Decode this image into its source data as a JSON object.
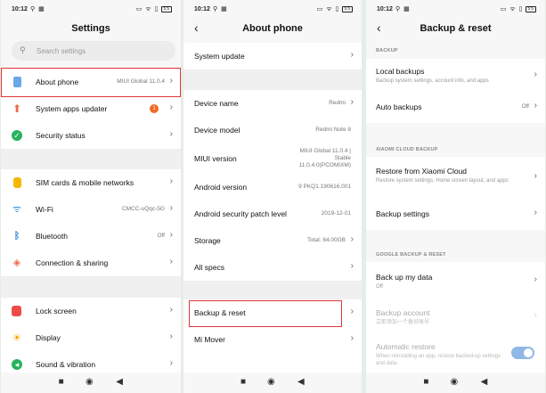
{
  "statusbar": {
    "time": "10:12",
    "left_icons": "⚲ ▦",
    "right_icons": "▭ ᯤ ▯",
    "battery": "55"
  },
  "panel1": {
    "title": "Settings",
    "search_placeholder": "Search settings",
    "items": [
      {
        "label": "About phone",
        "value": "MIUI Global 11.0.4",
        "icon_color": "#6aa8e8"
      },
      {
        "label": "System apps updater",
        "badge": "1",
        "icon_color": "#ef6b4c"
      },
      {
        "label": "Security status",
        "icon_color": "#27b35c"
      },
      {
        "label": "SIM cards & mobile networks",
        "icon_color": "#f5b800"
      },
      {
        "label": "Wi-Fi",
        "value": "CMCC-uQqc-5G",
        "icon_color": "#2b8ce0"
      },
      {
        "label": "Bluetooth",
        "value": "Off",
        "icon_color": "#2b8ce0"
      },
      {
        "label": "Connection & sharing",
        "icon_color": "#ef6b4c"
      },
      {
        "label": "Lock screen",
        "icon_color": "#ef4b4b"
      },
      {
        "label": "Display",
        "icon_color": "#f5a800"
      },
      {
        "label": "Sound & vibration",
        "icon_color": "#27b35c"
      }
    ]
  },
  "panel2": {
    "title": "About phone",
    "items": [
      {
        "label": "System update",
        "value": ""
      },
      {
        "label": "Device name",
        "value": "Redmi"
      },
      {
        "label": "Device model",
        "value": "Redmi Note 8"
      },
      {
        "label": "MIUI version",
        "value_lines": [
          "MIUI Global 11.0.4 |",
          "Stable",
          "11.0.4.0(PCOMIXM)"
        ]
      },
      {
        "label": "Android version",
        "value": "9 PKQ1.190616.001"
      },
      {
        "label": "Android security patch level",
        "value": "2019-12-01"
      },
      {
        "label": "Storage",
        "value": "Total: 64.00GB"
      },
      {
        "label": "All specs",
        "value": ""
      },
      {
        "label": "Backup & reset",
        "value": ""
      },
      {
        "label": "Mi Mover",
        "value": ""
      }
    ]
  },
  "panel3": {
    "title": "Backup & reset",
    "section_backup": "BACKUP",
    "local_backups": {
      "label": "Local backups",
      "sub": "Backup system settings, account info, and apps"
    },
    "auto_backups": {
      "label": "Auto backups",
      "value": "Off"
    },
    "section_cloud": "XIAOMI CLOUD BACKUP",
    "restore_cloud": {
      "label": "Restore from Xiaomi Cloud",
      "sub": "Restore system settings, Home screen layout, and apps"
    },
    "backup_settings": {
      "label": "Backup settings"
    },
    "section_google": "GOOGLE BACKUP & RESET",
    "back_up_data": {
      "label": "Back up my data",
      "sub": "Off"
    },
    "backup_account": {
      "label": "Backup account",
      "sub": "立即添加一个备份账号"
    },
    "auto_restore": {
      "label": "Automatic restore",
      "sub": "When reinstalling an app, restore backed-up settings and data"
    }
  },
  "navbar": {
    "recent": "■",
    "home": "◉",
    "back": "◀"
  }
}
